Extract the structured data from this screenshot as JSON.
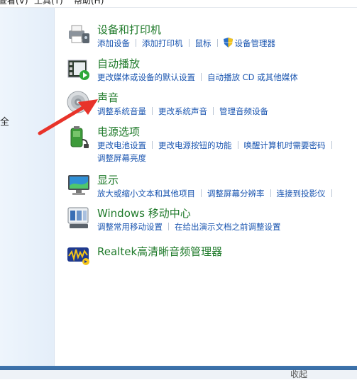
{
  "menubar": {
    "view": "查看(V)",
    "tools": "工具(T)",
    "help": "帮助(H)"
  },
  "left_pane": {
    "cut_text": "全"
  },
  "groups": [
    {
      "title": "设备和打印机",
      "icon": "printer-icon",
      "links": [
        "添加设备",
        "添加打印机",
        "鼠标",
        "设备管理器"
      ]
    },
    {
      "title": "自动播放",
      "icon": "autoplay-icon",
      "links": [
        "更改媒体或设备的默认设置",
        "自动播放 CD 或其他媒体"
      ]
    },
    {
      "title": "声音",
      "icon": "speaker-icon",
      "links": [
        "调整系统音量",
        "更改系统声音",
        "管理音频设备"
      ]
    },
    {
      "title": "电源选项",
      "icon": "battery-icon",
      "links": [
        "更改电池设置",
        "更改电源按钮的功能",
        "唤醒计算机时需要密码",
        "调整屏幕亮度"
      ]
    },
    {
      "title": "显示",
      "icon": "monitor-icon",
      "links": [
        "放大或缩小文本和其他项目",
        "调整屏幕分辨率",
        "连接到投影仪"
      ]
    },
    {
      "title": "Windows 移动中心",
      "icon": "mobility-center-icon",
      "links": [
        "调整常用移动设置",
        "在给出演示文档之前调整设置"
      ]
    },
    {
      "title": "Realtek高清晰音频管理器",
      "icon": "realtek-audio-icon",
      "links": []
    }
  ],
  "bottom": {
    "left_text": "",
    "right_text": "收起"
  },
  "colors": {
    "title": "#1f7a2a",
    "link": "#1a55b0",
    "arrow": "#e8332a"
  }
}
